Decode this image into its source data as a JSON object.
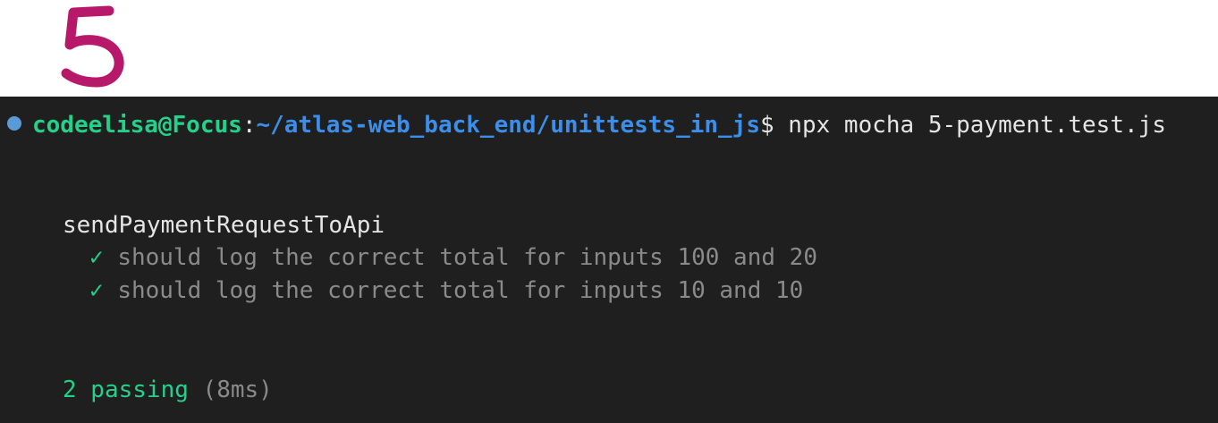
{
  "header": {
    "badge_number": "5",
    "badge_color": "#b8186a"
  },
  "terminal": {
    "prompt": {
      "user_host": "codeelisa@Focus",
      "separator": ":",
      "path": "~/atlas-web_back_end/unittests_in_js",
      "symbol": "$",
      "command": " npx mocha 5-payment.test.js"
    },
    "suite_name": "sendPaymentRequestToApi",
    "tests": [
      {
        "status_icon": "✓",
        "title": "should log the correct total for inputs 100 and 20"
      },
      {
        "status_icon": "✓",
        "title": "should log the correct total for inputs 10 and 10"
      }
    ],
    "summary": {
      "passing": "2 passing",
      "duration": "(8ms)"
    }
  },
  "colors": {
    "terminal_bg": "#1f1f1f",
    "user_green": "#23d18b",
    "path_blue": "#3b8eea",
    "dim_gray": "#8a8a8a"
  }
}
